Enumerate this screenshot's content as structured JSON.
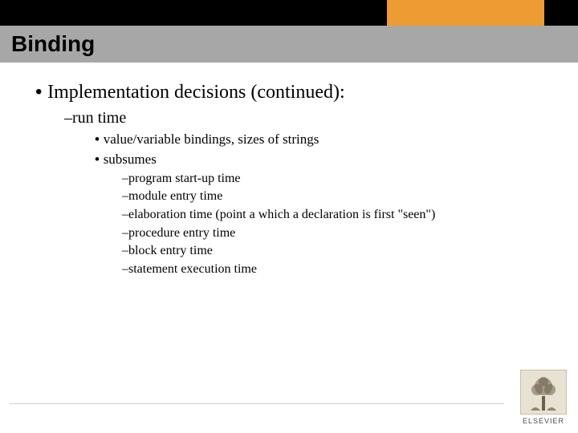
{
  "header": {
    "title": "Binding"
  },
  "content": {
    "level1": "Implementation decisions (continued):",
    "level2": "run time",
    "level3": [
      "value/variable bindings, sizes of strings",
      "subsumes"
    ],
    "level4": [
      "program start-up time",
      "module entry time",
      "elaboration time (point a which a declaration is first \"seen\")",
      "procedure entry time",
      "block entry time",
      "statement execution time"
    ]
  },
  "footer": {
    "publisher": "ELSEVIER"
  },
  "colors": {
    "accent_orange": "#ed9b33",
    "title_bar": "#a7a7a7",
    "top_bar": "#000000"
  }
}
